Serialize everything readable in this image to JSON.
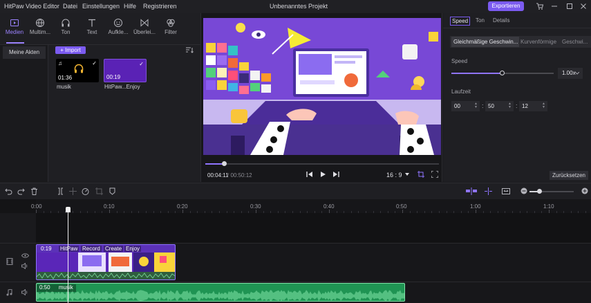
{
  "app": {
    "name": "HitPaw Video Editor",
    "menu": [
      "Datei",
      "Einstellungen",
      "Hilfe",
      "Registrieren"
    ],
    "project_title": "Unbenanntes Projekt",
    "export_label": "Exportieren"
  },
  "media_tools": [
    {
      "label": "Medien",
      "icon": "media-icon",
      "active": true
    },
    {
      "label": "Multim...",
      "icon": "globe-icon",
      "active": false
    },
    {
      "label": "Ton",
      "icon": "headphones-icon",
      "active": false
    },
    {
      "label": "Text",
      "icon": "text-icon",
      "active": false
    },
    {
      "label": "Aufkle...",
      "icon": "sticker-icon",
      "active": false
    },
    {
      "label": "Überlei...",
      "icon": "transition-icon",
      "active": false
    },
    {
      "label": "Filter",
      "icon": "filter-icon",
      "active": false
    }
  ],
  "side_nav": {
    "item": "Meine Akten"
  },
  "import_label": "+ Import",
  "media_items": [
    {
      "name": "musik",
      "duration": "01:36",
      "type": "audio"
    },
    {
      "name": "HitPaw...Enjoy",
      "duration": "00:19",
      "type": "video"
    }
  ],
  "player": {
    "current": "00:04:11",
    "total": "/ 00:50:12",
    "ratio": "16 : 9",
    "progress": 0.08
  },
  "right_panel": {
    "tabs": [
      "Speed",
      "Ton",
      "Details"
    ],
    "active_tab": "Speed",
    "speed_modes": [
      "Gleichmäßige Geschwin...",
      "Kurvenförmige",
      "Geschwi..."
    ],
    "speed_label": "Speed",
    "speed_value": "1.00x",
    "speed_fraction": 0.49,
    "duration_label": "Laufzeit",
    "duration_fields": [
      "00",
      "50",
      "12"
    ],
    "reset_label": "Zurücksetzen"
  },
  "timeline": {
    "ruler": [
      "0:00",
      "0:10",
      "0:20",
      "0:30",
      "0:40",
      "0:50",
      "1:00",
      "1:10"
    ],
    "video_clip": {
      "duration": "0:19",
      "labels": [
        "HitPaw",
        "Record",
        "Create",
        "Enjoy"
      ]
    },
    "audio_clip": {
      "duration": "0:50",
      "name": "musik"
    },
    "zoom_fraction": 0.22
  },
  "colors": {
    "accent": "#7b5bf0",
    "video_track": "#5b31b8",
    "audio_track": "#1f9453"
  }
}
